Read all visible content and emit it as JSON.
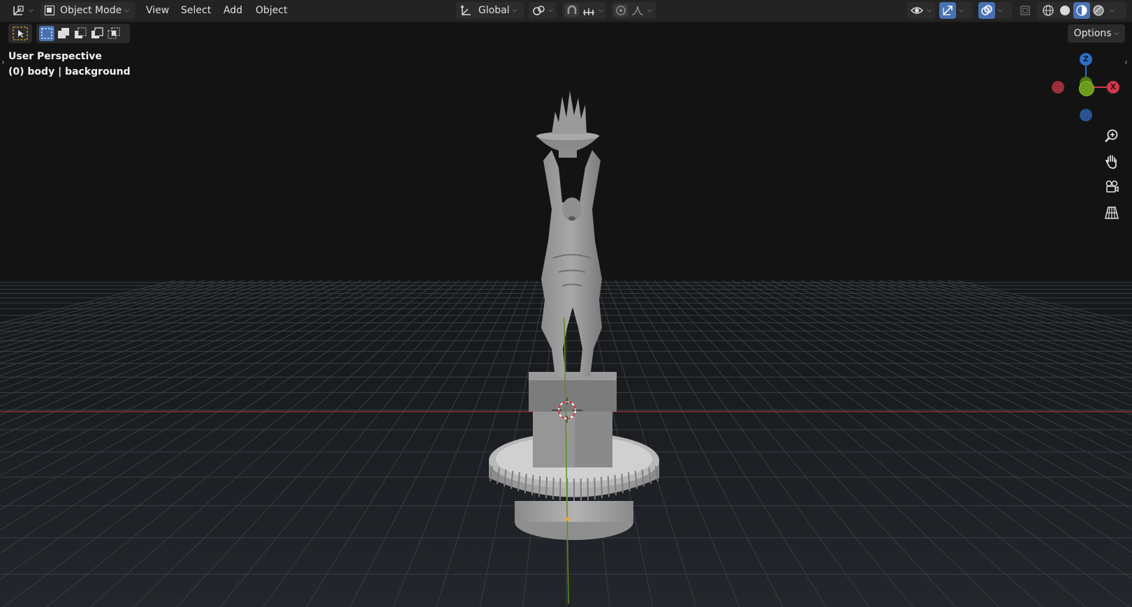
{
  "header": {
    "editor_type_icon": "3d-viewport-icon",
    "mode_label": "Object Mode",
    "menus": [
      "View",
      "Select",
      "Add",
      "Object"
    ],
    "transform_orientation": "Global"
  },
  "toolbar": {
    "options_label": "Options"
  },
  "viewport": {
    "view_name": "User Perspective",
    "object_info": "(0) body | background"
  },
  "gizmo": {
    "z_label": "Z",
    "x_label": "X"
  },
  "colors": {
    "header_bg": "#232323",
    "accent_blue": "#4772b3",
    "axis_x": "#d0384b",
    "axis_y": "#6b9c1c",
    "axis_z": "#2f6fc9",
    "grid_line": "#3a3e43"
  }
}
